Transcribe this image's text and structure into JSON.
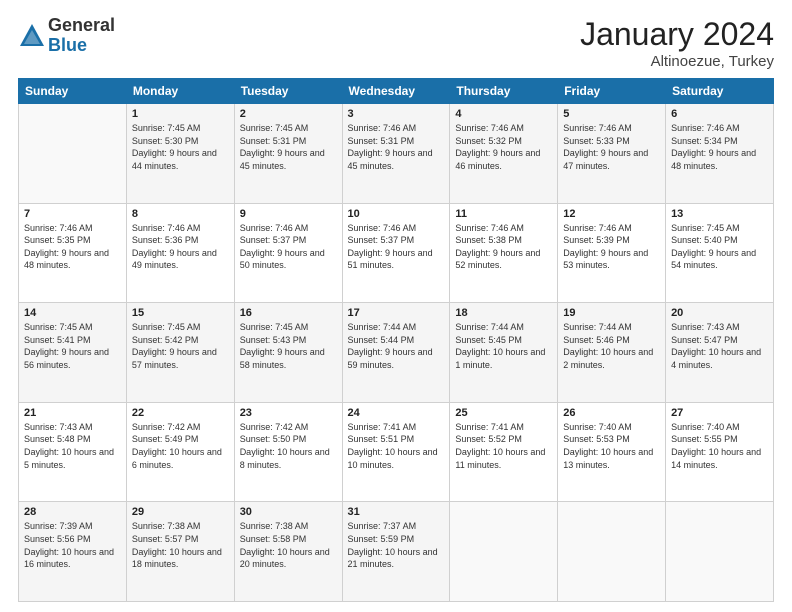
{
  "header": {
    "logo_general": "General",
    "logo_blue": "Blue",
    "month_title": "January 2024",
    "location": "Altinoezue, Turkey"
  },
  "days_of_week": [
    "Sunday",
    "Monday",
    "Tuesday",
    "Wednesday",
    "Thursday",
    "Friday",
    "Saturday"
  ],
  "weeks": [
    [
      {
        "day": "",
        "sunrise": "",
        "sunset": "",
        "daylight": ""
      },
      {
        "day": "1",
        "sunrise": "Sunrise: 7:45 AM",
        "sunset": "Sunset: 5:30 PM",
        "daylight": "Daylight: 9 hours and 44 minutes."
      },
      {
        "day": "2",
        "sunrise": "Sunrise: 7:45 AM",
        "sunset": "Sunset: 5:31 PM",
        "daylight": "Daylight: 9 hours and 45 minutes."
      },
      {
        "day": "3",
        "sunrise": "Sunrise: 7:46 AM",
        "sunset": "Sunset: 5:31 PM",
        "daylight": "Daylight: 9 hours and 45 minutes."
      },
      {
        "day": "4",
        "sunrise": "Sunrise: 7:46 AM",
        "sunset": "Sunset: 5:32 PM",
        "daylight": "Daylight: 9 hours and 46 minutes."
      },
      {
        "day": "5",
        "sunrise": "Sunrise: 7:46 AM",
        "sunset": "Sunset: 5:33 PM",
        "daylight": "Daylight: 9 hours and 47 minutes."
      },
      {
        "day": "6",
        "sunrise": "Sunrise: 7:46 AM",
        "sunset": "Sunset: 5:34 PM",
        "daylight": "Daylight: 9 hours and 48 minutes."
      }
    ],
    [
      {
        "day": "7",
        "sunrise": "Sunrise: 7:46 AM",
        "sunset": "Sunset: 5:35 PM",
        "daylight": "Daylight: 9 hours and 48 minutes."
      },
      {
        "day": "8",
        "sunrise": "Sunrise: 7:46 AM",
        "sunset": "Sunset: 5:36 PM",
        "daylight": "Daylight: 9 hours and 49 minutes."
      },
      {
        "day": "9",
        "sunrise": "Sunrise: 7:46 AM",
        "sunset": "Sunset: 5:37 PM",
        "daylight": "Daylight: 9 hours and 50 minutes."
      },
      {
        "day": "10",
        "sunrise": "Sunrise: 7:46 AM",
        "sunset": "Sunset: 5:37 PM",
        "daylight": "Daylight: 9 hours and 51 minutes."
      },
      {
        "day": "11",
        "sunrise": "Sunrise: 7:46 AM",
        "sunset": "Sunset: 5:38 PM",
        "daylight": "Daylight: 9 hours and 52 minutes."
      },
      {
        "day": "12",
        "sunrise": "Sunrise: 7:46 AM",
        "sunset": "Sunset: 5:39 PM",
        "daylight": "Daylight: 9 hours and 53 minutes."
      },
      {
        "day": "13",
        "sunrise": "Sunrise: 7:45 AM",
        "sunset": "Sunset: 5:40 PM",
        "daylight": "Daylight: 9 hours and 54 minutes."
      }
    ],
    [
      {
        "day": "14",
        "sunrise": "Sunrise: 7:45 AM",
        "sunset": "Sunset: 5:41 PM",
        "daylight": "Daylight: 9 hours and 56 minutes."
      },
      {
        "day": "15",
        "sunrise": "Sunrise: 7:45 AM",
        "sunset": "Sunset: 5:42 PM",
        "daylight": "Daylight: 9 hours and 57 minutes."
      },
      {
        "day": "16",
        "sunrise": "Sunrise: 7:45 AM",
        "sunset": "Sunset: 5:43 PM",
        "daylight": "Daylight: 9 hours and 58 minutes."
      },
      {
        "day": "17",
        "sunrise": "Sunrise: 7:44 AM",
        "sunset": "Sunset: 5:44 PM",
        "daylight": "Daylight: 9 hours and 59 minutes."
      },
      {
        "day": "18",
        "sunrise": "Sunrise: 7:44 AM",
        "sunset": "Sunset: 5:45 PM",
        "daylight": "Daylight: 10 hours and 1 minute."
      },
      {
        "day": "19",
        "sunrise": "Sunrise: 7:44 AM",
        "sunset": "Sunset: 5:46 PM",
        "daylight": "Daylight: 10 hours and 2 minutes."
      },
      {
        "day": "20",
        "sunrise": "Sunrise: 7:43 AM",
        "sunset": "Sunset: 5:47 PM",
        "daylight": "Daylight: 10 hours and 4 minutes."
      }
    ],
    [
      {
        "day": "21",
        "sunrise": "Sunrise: 7:43 AM",
        "sunset": "Sunset: 5:48 PM",
        "daylight": "Daylight: 10 hours and 5 minutes."
      },
      {
        "day": "22",
        "sunrise": "Sunrise: 7:42 AM",
        "sunset": "Sunset: 5:49 PM",
        "daylight": "Daylight: 10 hours and 6 minutes."
      },
      {
        "day": "23",
        "sunrise": "Sunrise: 7:42 AM",
        "sunset": "Sunset: 5:50 PM",
        "daylight": "Daylight: 10 hours and 8 minutes."
      },
      {
        "day": "24",
        "sunrise": "Sunrise: 7:41 AM",
        "sunset": "Sunset: 5:51 PM",
        "daylight": "Daylight: 10 hours and 10 minutes."
      },
      {
        "day": "25",
        "sunrise": "Sunrise: 7:41 AM",
        "sunset": "Sunset: 5:52 PM",
        "daylight": "Daylight: 10 hours and 11 minutes."
      },
      {
        "day": "26",
        "sunrise": "Sunrise: 7:40 AM",
        "sunset": "Sunset: 5:53 PM",
        "daylight": "Daylight: 10 hours and 13 minutes."
      },
      {
        "day": "27",
        "sunrise": "Sunrise: 7:40 AM",
        "sunset": "Sunset: 5:55 PM",
        "daylight": "Daylight: 10 hours and 14 minutes."
      }
    ],
    [
      {
        "day": "28",
        "sunrise": "Sunrise: 7:39 AM",
        "sunset": "Sunset: 5:56 PM",
        "daylight": "Daylight: 10 hours and 16 minutes."
      },
      {
        "day": "29",
        "sunrise": "Sunrise: 7:38 AM",
        "sunset": "Sunset: 5:57 PM",
        "daylight": "Daylight: 10 hours and 18 minutes."
      },
      {
        "day": "30",
        "sunrise": "Sunrise: 7:38 AM",
        "sunset": "Sunset: 5:58 PM",
        "daylight": "Daylight: 10 hours and 20 minutes."
      },
      {
        "day": "31",
        "sunrise": "Sunrise: 7:37 AM",
        "sunset": "Sunset: 5:59 PM",
        "daylight": "Daylight: 10 hours and 21 minutes."
      },
      {
        "day": "",
        "sunrise": "",
        "sunset": "",
        "daylight": ""
      },
      {
        "day": "",
        "sunrise": "",
        "sunset": "",
        "daylight": ""
      },
      {
        "day": "",
        "sunrise": "",
        "sunset": "",
        "daylight": ""
      }
    ]
  ]
}
